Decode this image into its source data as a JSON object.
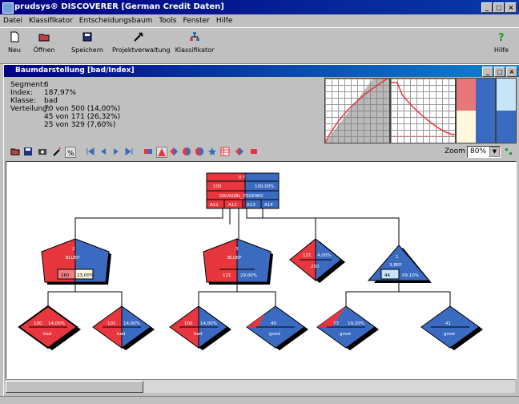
{
  "window": {
    "title": "prudsys® DISCOVERER [German Credit Daten]"
  },
  "menu": [
    "Datei",
    "Klassifikator",
    "Entscheidungsbaum",
    "Tools",
    "Fenster",
    "Hilfe"
  ],
  "toolbar": [
    {
      "label": "Neu",
      "icon": "new-document-icon"
    },
    {
      "label": "Öffnen",
      "icon": "open-folder-icon"
    },
    {
      "label": "Speichern",
      "icon": "save-disk-icon"
    },
    {
      "label": "Projektverwaltung",
      "icon": "tools-icon"
    },
    {
      "label": "Klassifikator",
      "icon": "tree-icon"
    },
    {
      "label": "Hilfe",
      "icon": "help-icon"
    }
  ],
  "child": {
    "title": "Baumdarstellung [bad/Index]"
  },
  "info": {
    "segment_label": "Segment:",
    "segment": "6",
    "index_label": "Index:",
    "index": "187,97%",
    "klasse_label": "Klasse:",
    "klasse": "bad",
    "verteilung_label": "Verteilung:",
    "verteilung": [
      "70 von 500   (14,00%)",
      "45 von 171   (26,32%)",
      "25 von 329   (7,60%)"
    ]
  },
  "zoom": {
    "label": "Zoom",
    "value": "80%"
  },
  "tree": {
    "root": {
      "id": "0 T",
      "left": "100",
      "right": "100,00%",
      "attr": "DAUSGBL_ZSGEWIC",
      "tabs": [
        "A11",
        "A12",
        "A13",
        "A14"
      ]
    },
    "level1": [
      {
        "id": "2",
        "split": "BLUEP",
        "left": "160",
        "right": "23,00%"
      },
      {
        "id": "3",
        "split": "BLUEP",
        "left": "121",
        "right": "29,00%"
      },
      {
        "id": "",
        "split": "",
        "left": "121",
        "right": "4,00%",
        "extra": "250"
      },
      {
        "id": "1",
        "split": "3,8EP",
        "left": "44",
        "right": "09,10%"
      }
    ],
    "level2": [
      {
        "left": "100",
        "right": "14,00%",
        "cls": "bad"
      },
      {
        "left": "101",
        "right": "14,00%",
        "cls": "bad"
      },
      {
        "left": "100",
        "right": "14,00%",
        "cls": "bad"
      },
      {
        "left": "40",
        "right": "",
        "cls": "good"
      },
      {
        "left": "73",
        "right": "19,20%",
        "cls": "good"
      },
      {
        "left": "41",
        "right": "",
        "cls": "good"
      }
    ]
  },
  "colors": {
    "red": "#e8363f",
    "blue": "#3a6bc0",
    "titlebar": "#000080"
  }
}
